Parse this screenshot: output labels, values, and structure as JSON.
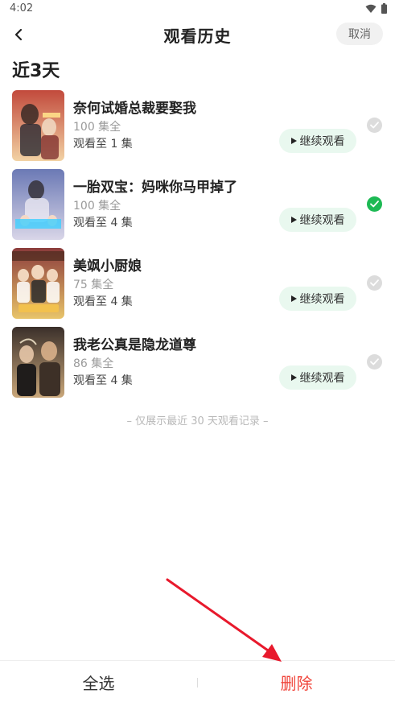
{
  "status_bar": {
    "time": "4:02",
    "icons": [
      "wifi-icon",
      "battery-icon"
    ]
  },
  "header": {
    "title": "观看历史",
    "back_icon": "chevron-left-icon",
    "cancel_label": "取消"
  },
  "section_title": "近3天",
  "items": [
    {
      "title": "奈何试婚总裁要娶我",
      "total": "100 集全",
      "progress": "观看至 1 集",
      "continue_label": "继续观看",
      "selected": false,
      "poster_colors": [
        "#c24a3c",
        "#f2d2a4"
      ]
    },
    {
      "title": "一胎双宝：妈咪你马甲掉了",
      "total": "100 集全",
      "progress": "观看至 4 集",
      "continue_label": "继续观看",
      "selected": true,
      "poster_colors": [
        "#6b79b5",
        "#d9d6e8"
      ]
    },
    {
      "title": "美飒小厨娘",
      "total": "75 集全",
      "progress": "观看至 4 集",
      "continue_label": "继续观看",
      "selected": false,
      "poster_colors": [
        "#8b3b3b",
        "#e8c46a"
      ]
    },
    {
      "title": "我老公真是隐龙道尊",
      "total": "86 集全",
      "progress": "观看至 4 集",
      "continue_label": "继续观看",
      "selected": false,
      "poster_colors": [
        "#3a2f2a",
        "#c9a77a"
      ]
    }
  ],
  "footer_note": "– 仅展示最近 30 天观看记录 –",
  "bottom_bar": {
    "select_all_label": "全选",
    "delete_label": "删除"
  },
  "colors": {
    "accent_green": "#1db954",
    "continue_bg": "#e9f8ef",
    "delete_red": "#f0443a",
    "annotation_red": "#e8192c"
  }
}
